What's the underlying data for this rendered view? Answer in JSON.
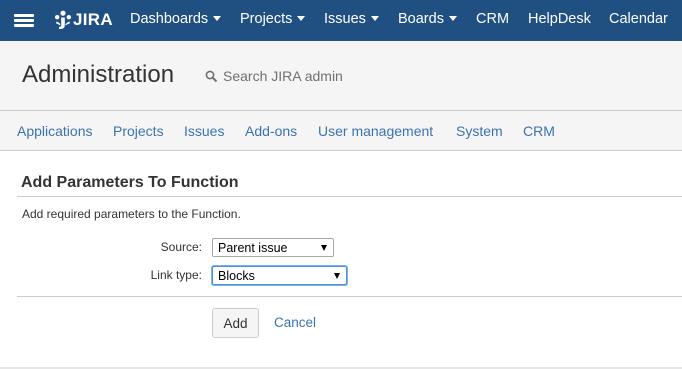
{
  "topnav": {
    "logo_text": "JIRA",
    "items": [
      {
        "label": "Dashboards",
        "dropdown": true
      },
      {
        "label": "Projects",
        "dropdown": true
      },
      {
        "label": "Issues",
        "dropdown": true
      },
      {
        "label": "Boards",
        "dropdown": true
      },
      {
        "label": "CRM",
        "dropdown": false
      },
      {
        "label": "HelpDesk",
        "dropdown": false
      },
      {
        "label": "Calendar",
        "dropdown": false
      }
    ]
  },
  "admin_header": {
    "title": "Administration",
    "search_placeholder": "Search JIRA admin"
  },
  "tabs": [
    "Applications",
    "Projects",
    "Issues",
    "Add-ons",
    "User management",
    "System",
    "CRM"
  ],
  "form": {
    "heading": "Add Parameters To Function",
    "description": "Add required parameters to the Function.",
    "source_label": "Source:",
    "source_value": "Parent issue",
    "link_type_label": "Link type:",
    "link_type_value": "Blocks",
    "add_label": "Add",
    "cancel_label": "Cancel"
  },
  "colors": {
    "topnav_bg": "#205081",
    "link": "#3b73af",
    "header_bg": "#f5f5f5"
  },
  "icons": [
    "menu-icon",
    "jira-logo-icon",
    "search-icon",
    "chevron-down-icon"
  ]
}
